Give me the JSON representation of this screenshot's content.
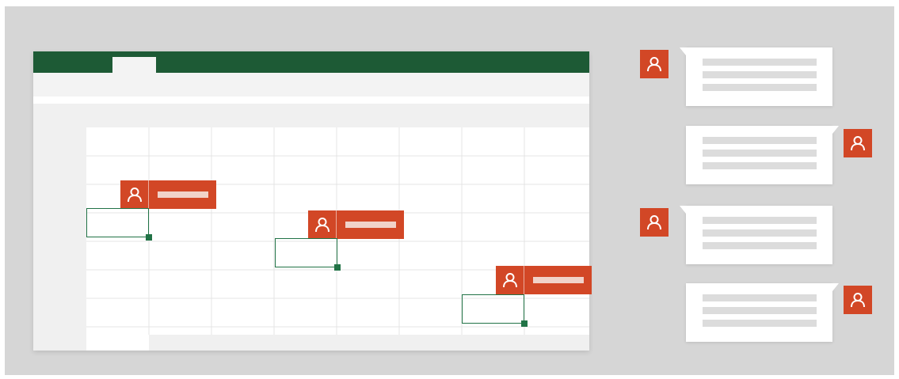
{
  "colors": {
    "background": "#d6d6d6",
    "ribbon": "#1d5a35",
    "accent": "#d24726",
    "selection": "#217346",
    "gridline": "#e4e4e4",
    "comment_line": "#dcdcdc"
  },
  "icons": {
    "avatar": "person-icon"
  },
  "spreadsheet": {
    "columns": 8,
    "rows": 7
  },
  "collaborators": [
    {
      "name": ""
    },
    {
      "name": ""
    },
    {
      "name": ""
    }
  ],
  "comments": [
    {
      "side": "left",
      "lines": 3
    },
    {
      "side": "right",
      "lines": 3
    },
    {
      "side": "left",
      "lines": 3
    },
    {
      "side": "right",
      "lines": 3
    }
  ]
}
